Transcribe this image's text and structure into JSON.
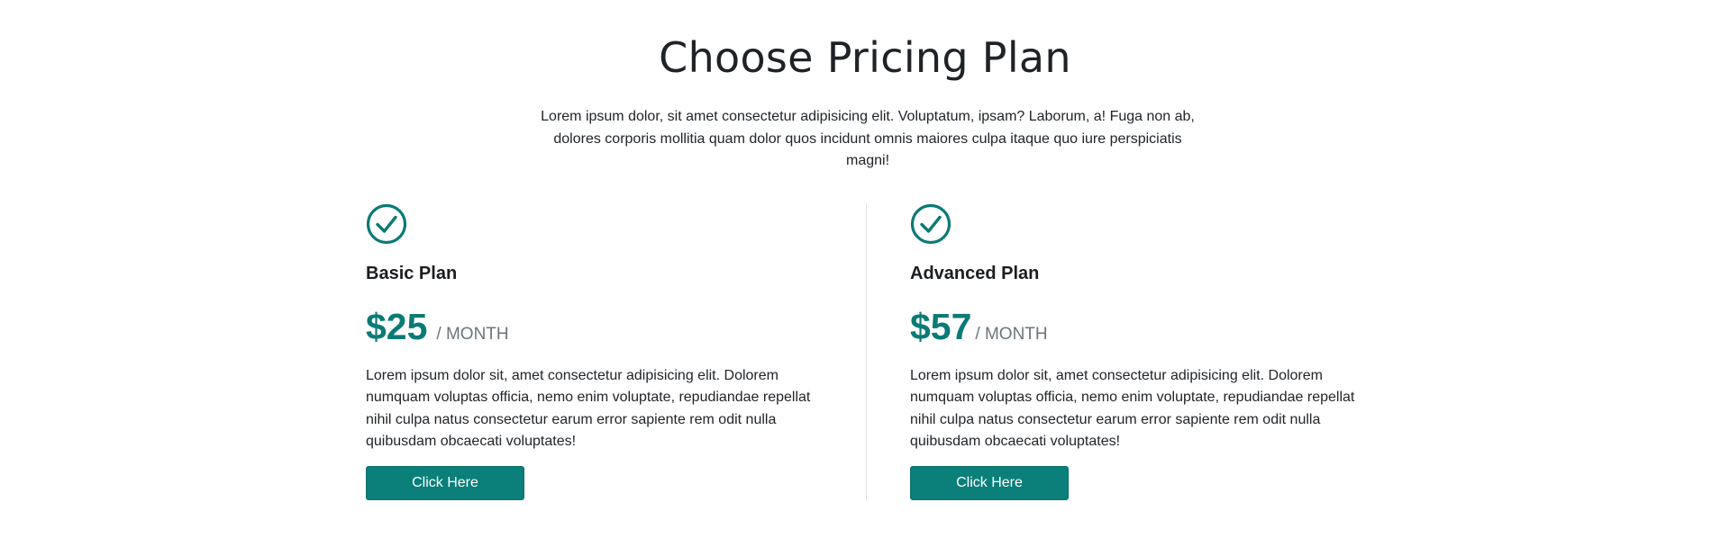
{
  "header": {
    "title": "Choose Pricing Plan",
    "description": "Lorem ipsum dolor, sit amet consectetur adipisicing elit. Voluptatum, ipsam? Laborum, a! Fuga non ab, dolores corporis mollitia quam dolor quos incidunt omnis maiores culpa itaque quo iure perspiciatis magni!"
  },
  "colors": {
    "accent": "#0b7a75",
    "button": "#0b7f7a",
    "muted": "#6c757d"
  },
  "plans": [
    {
      "icon": "check-circle-icon",
      "name": "Basic Plan",
      "price": "$25",
      "period": "/ MONTH",
      "description": "Lorem ipsum dolor sit, amet consectetur adipisicing elit. Dolorem numquam voluptas officia, nemo enim voluptate, repudiandae repellat nihil culpa natus consectetur earum error sapiente rem odit nulla quibusdam obcaecati voluptates!",
      "button_label": "Click Here"
    },
    {
      "icon": "check-circle-icon",
      "name": "Advanced Plan",
      "price": "$57",
      "period": "/ MONTH",
      "description": "Lorem ipsum dolor sit, amet consectetur adipisicing elit. Dolorem numquam voluptas officia, nemo enim voluptate, repudiandae repellat nihil culpa natus consectetur earum error sapiente rem odit nulla quibusdam obcaecati voluptates!",
      "button_label": "Click Here"
    }
  ]
}
